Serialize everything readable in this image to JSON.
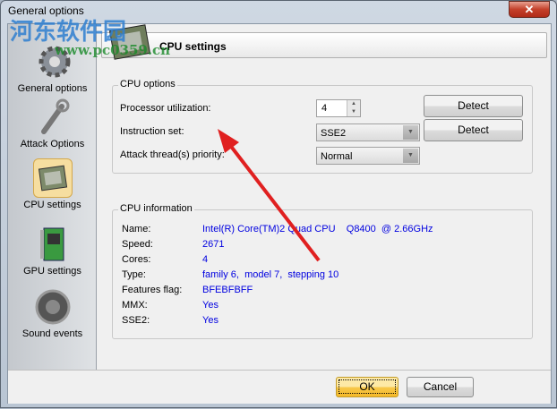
{
  "window": {
    "title": "General options",
    "close": "✕"
  },
  "watermark": {
    "name": "河东软件园",
    "url": "www.pc0359.cn"
  },
  "sidebar": {
    "items": [
      {
        "label": "General options",
        "icon": "gear-icon"
      },
      {
        "label": "Attack Options",
        "icon": "wrench-icon"
      },
      {
        "label": "CPU settings",
        "icon": "cpu-icon",
        "selected": true
      },
      {
        "label": "GPU settings",
        "icon": "gpu-card-icon"
      },
      {
        "label": "Sound events",
        "icon": "speaker-icon"
      }
    ]
  },
  "header": {
    "title": "CPU settings"
  },
  "cpu_options": {
    "legend": "CPU options",
    "processor_utilization": {
      "label": "Processor utilization:",
      "value": "4"
    },
    "instruction_set": {
      "label": "Instruction set:",
      "value": "SSE2"
    },
    "priority": {
      "label": "Attack thread(s) priority:",
      "value": "Normal"
    },
    "detect1": "Detect",
    "detect2": "Detect"
  },
  "cpu_info": {
    "legend": "CPU information",
    "rows": [
      {
        "label": "Name:",
        "value": "Intel(R) Core(TM)2 Quad CPU    Q8400  @ 2.66GHz"
      },
      {
        "label": "Speed:",
        "value": "2671"
      },
      {
        "label": "Cores:",
        "value": "4"
      },
      {
        "label": "Type:",
        "value": "family 6,  model 7,  stepping 10"
      },
      {
        "label": "Features flag:",
        "value": "BFEBFBFF"
      },
      {
        "label": "MMX:",
        "value": "Yes"
      },
      {
        "label": "SSE2:",
        "value": "Yes"
      }
    ]
  },
  "footer": {
    "ok": "OK",
    "cancel": "Cancel"
  },
  "colors": {
    "value_text": "#0000e0",
    "arrow": "#e02020"
  }
}
